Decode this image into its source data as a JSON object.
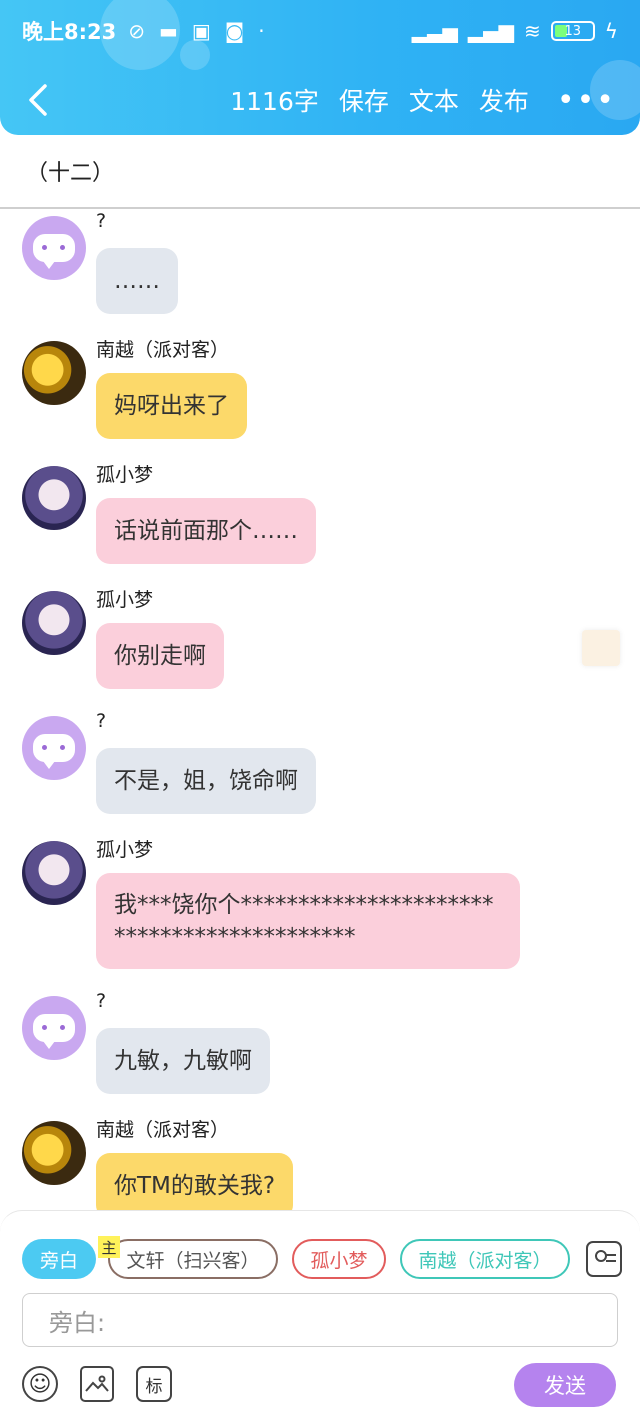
{
  "status_bar": {
    "time": "晚上8:23",
    "battery": "13"
  },
  "toolbar": {
    "word_count": "1116字",
    "save_label": "保存",
    "text_label": "文本",
    "publish_label": "发布",
    "more_label": "•••"
  },
  "chapter": {
    "title": "（十二）"
  },
  "messages": [
    {
      "name": "?",
      "text": "……"
    },
    {
      "name": "南越（派对客）",
      "text": "妈呀出来了"
    },
    {
      "name": "孤小梦",
      "text": "话说前面那个……"
    },
    {
      "name": "孤小梦",
      "text": "你别走啊"
    },
    {
      "name": "?",
      "text": "不是，姐，饶命啊"
    },
    {
      "name": "孤小梦",
      "text": "我***饶你个*******************************************"
    },
    {
      "name": "?",
      "text": "九敏，九敏啊"
    },
    {
      "name": "南越（派对客）",
      "text": "你TM的敢关我?"
    }
  ],
  "composer": {
    "roles": [
      "旁白",
      "文轩（扫兴客）",
      "孤小梦",
      "南越（派对客）"
    ],
    "main_tag": "主",
    "input_placeholder": "旁白:",
    "tag_tool_label": "标",
    "send_label": "发送",
    "colors": {
      "narrator": "#4ccaf2",
      "wenxuan": "#8a6e64",
      "gu": "#e25c5c",
      "nanyue": "#3fc7b8",
      "send": "#b583ee"
    }
  }
}
